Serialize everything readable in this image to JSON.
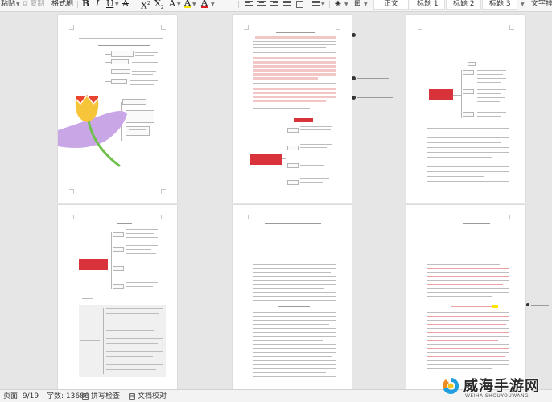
{
  "toolbar": {
    "paste_label": "粘贴",
    "copy_label": "复制",
    "format_painter_label": "格式刷",
    "bold": "B",
    "italic": "I",
    "underline": "U",
    "strike": "A",
    "superscript": "X",
    "subscript": "X",
    "text_effects": "A",
    "highlight": "A",
    "font_color": "A",
    "styles": [
      "正文",
      "标题 1",
      "标题 2",
      "标题 3"
    ],
    "text_layout_label": "文字排"
  },
  "statusbar": {
    "page_info": "页面: 9/19",
    "word_count": "字数: 13686",
    "spell_check_label": "拼写检查",
    "proofread_label": "文档校对"
  },
  "watermark": {
    "cn": "威海手游网",
    "en": "WEIHAISHOUYOUWANG"
  },
  "colors": {
    "accent_red": "#d8333b",
    "highlight_pink": "#f3c6c6",
    "flower_purple": "#c9a6e6",
    "flower_yellow": "#f6c53a",
    "stem_green": "#6fbf4a"
  }
}
